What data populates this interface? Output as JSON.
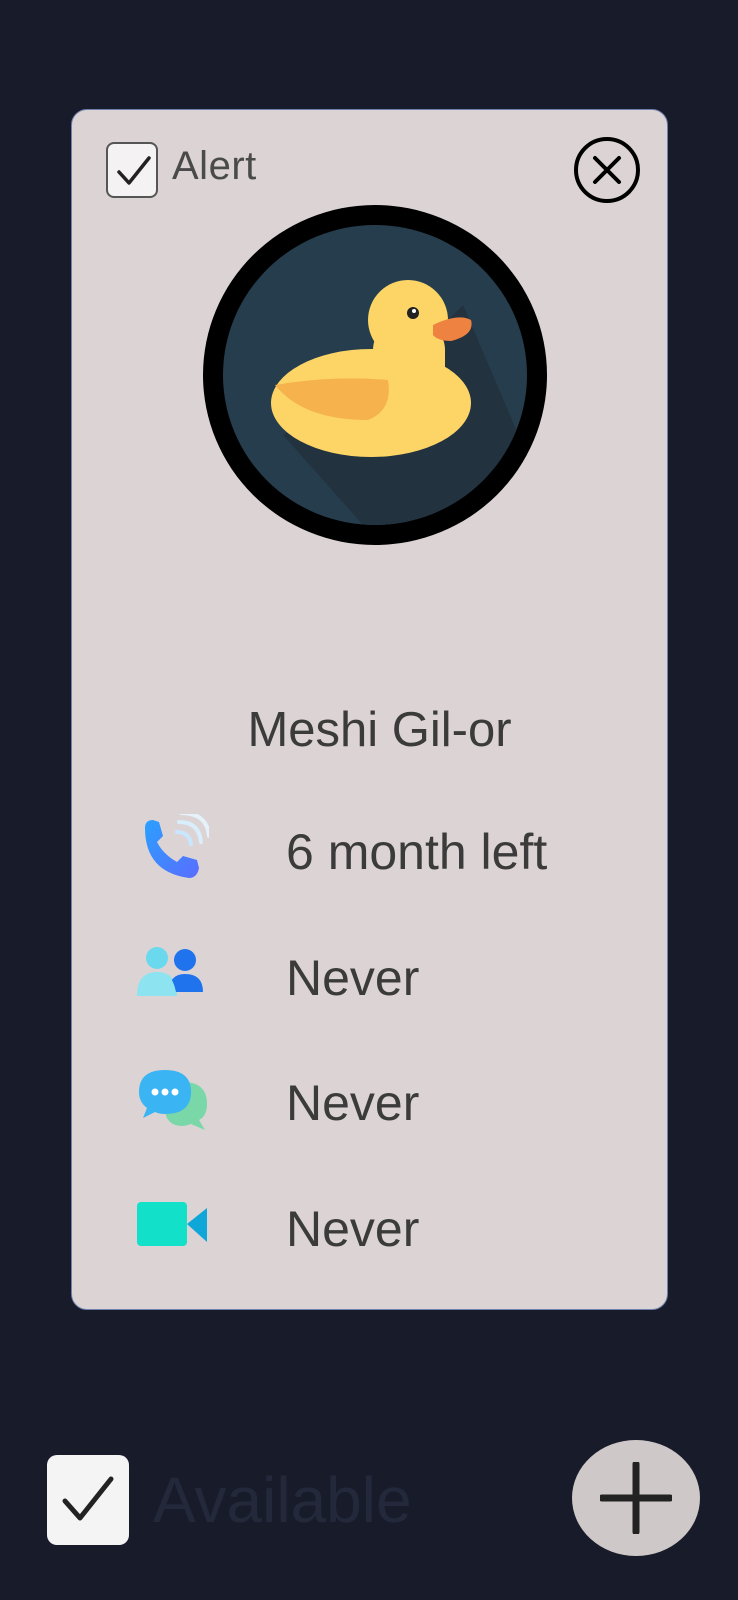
{
  "card": {
    "alert_label": "Alert",
    "alert_checked": true,
    "name": "Meshi Gil-or",
    "rows": [
      {
        "icon": "phone-call-icon",
        "value": "6 month left"
      },
      {
        "icon": "people-icon",
        "value": "Never"
      },
      {
        "icon": "chat-bubbles-icon",
        "value": "Never"
      },
      {
        "icon": "video-camera-icon",
        "value": "Never"
      }
    ]
  },
  "footer": {
    "available_label": "Available",
    "available_checked": true
  },
  "colors": {
    "background": "#181c2a",
    "card": "#dcd4d4",
    "avatar_bg": "#263d4d",
    "duck": "#fdd567",
    "add_button": "#cfc8c8"
  }
}
